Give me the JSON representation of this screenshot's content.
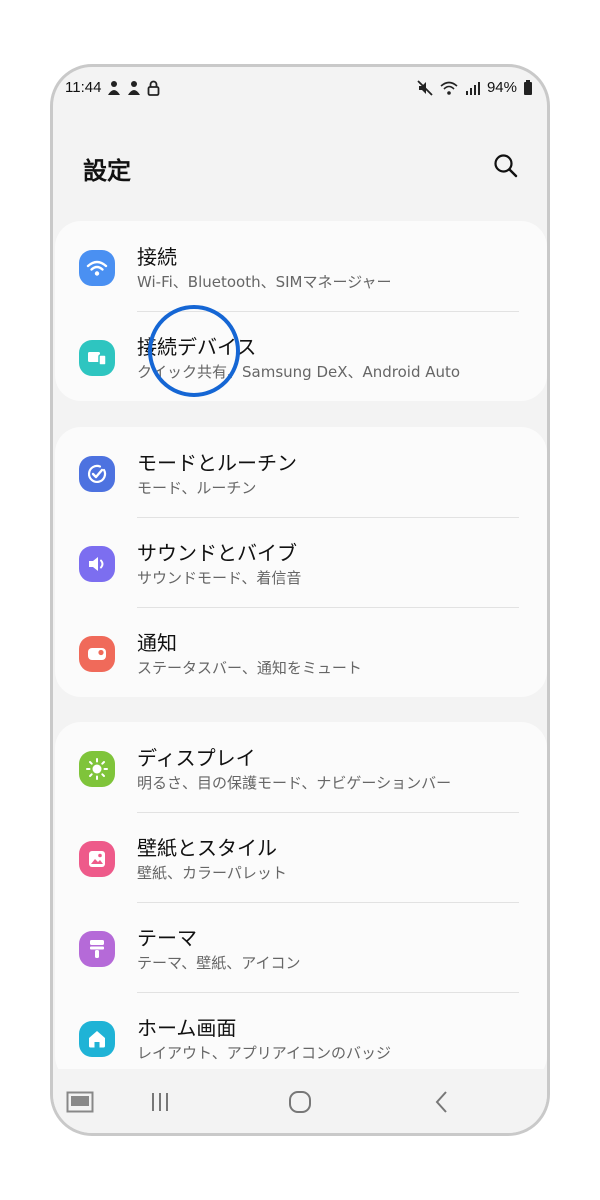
{
  "status": {
    "time": "11:44",
    "battery": "94%",
    "left_icons": [
      "notification-person-icon",
      "notification-person-icon",
      "lock-icon"
    ],
    "right_icons": [
      "mute-icon",
      "wifi-icon",
      "signal-icon",
      "battery-icon"
    ]
  },
  "header": {
    "title": "設定"
  },
  "groups": [
    {
      "items": [
        {
          "label": "接続",
          "sub": "Wi-Fi、Bluetooth、SIMマネージャー",
          "icon": "wifi-icon",
          "color": "#4a90f2"
        },
        {
          "label": "接続デバイス",
          "sub": "クイック共有、Samsung DeX、Android Auto",
          "icon": "connected-devices-icon",
          "color": "#2ec5c0"
        }
      ]
    },
    {
      "items": [
        {
          "label": "モードとルーチン",
          "sub": "モード、ルーチン",
          "icon": "modes-check-icon",
          "color": "#4d72e0"
        },
        {
          "label": "サウンドとバイブ",
          "sub": "サウンドモード、着信音",
          "icon": "sound-icon",
          "color": "#7c6ef0"
        },
        {
          "label": "通知",
          "sub": "ステータスバー、通知をミュート",
          "icon": "notification-icon",
          "color": "#f06a5a"
        }
      ]
    },
    {
      "items": [
        {
          "label": "ディスプレイ",
          "sub": "明るさ、目の保護モード、ナビゲーションバー",
          "icon": "sun-icon",
          "color": "#7fc43a"
        },
        {
          "label": "壁紙とスタイル",
          "sub": "壁紙、カラーパレット",
          "icon": "wallpaper-icon",
          "color": "#ee5a8a"
        },
        {
          "label": "テーマ",
          "sub": "テーマ、壁紙、アイコン",
          "icon": "theme-brush-icon",
          "color": "#b56ad8"
        },
        {
          "label": "ホーム画面",
          "sub": "レイアウト、アプリアイコンのバッジ",
          "icon": "home-icon",
          "color": "#1fb3d6"
        }
      ]
    }
  ],
  "nav": {
    "buttons": [
      "keyboard-icon",
      "recents-icon",
      "home-button-icon",
      "back-icon"
    ]
  },
  "highlight_color": "#1566d4"
}
